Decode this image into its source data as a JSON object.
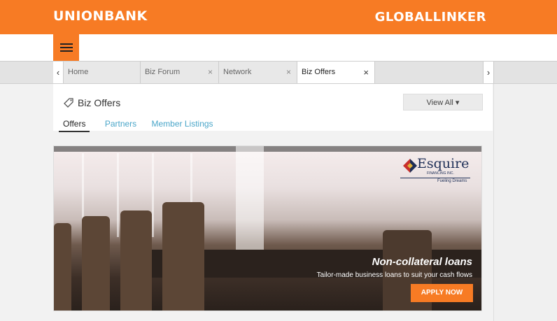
{
  "brand": {
    "left_logo": "UNIONBANK",
    "right_logo": "GLOBALLINKER",
    "accent": "#f77b24"
  },
  "tabs": [
    {
      "label": "Home"
    },
    {
      "label": "Biz Forum"
    },
    {
      "label": "Network"
    },
    {
      "label": "Biz Offers"
    }
  ],
  "tab_nav": {
    "prev": "‹",
    "next": "›",
    "close": "×"
  },
  "page": {
    "title": "Biz Offers",
    "view_all": "View All ▾",
    "subtabs": [
      "Offers",
      "Partners",
      "Member Listings"
    ]
  },
  "banner": {
    "brand_name": "Esquire",
    "brand_fin": "FINANCING INC.",
    "brand_tagline": "Fueling Dreams",
    "headline": "Non-collateral loans",
    "subline": "Tailor-made business loans to suit your cash flows",
    "cta": "APPLY NOW"
  }
}
